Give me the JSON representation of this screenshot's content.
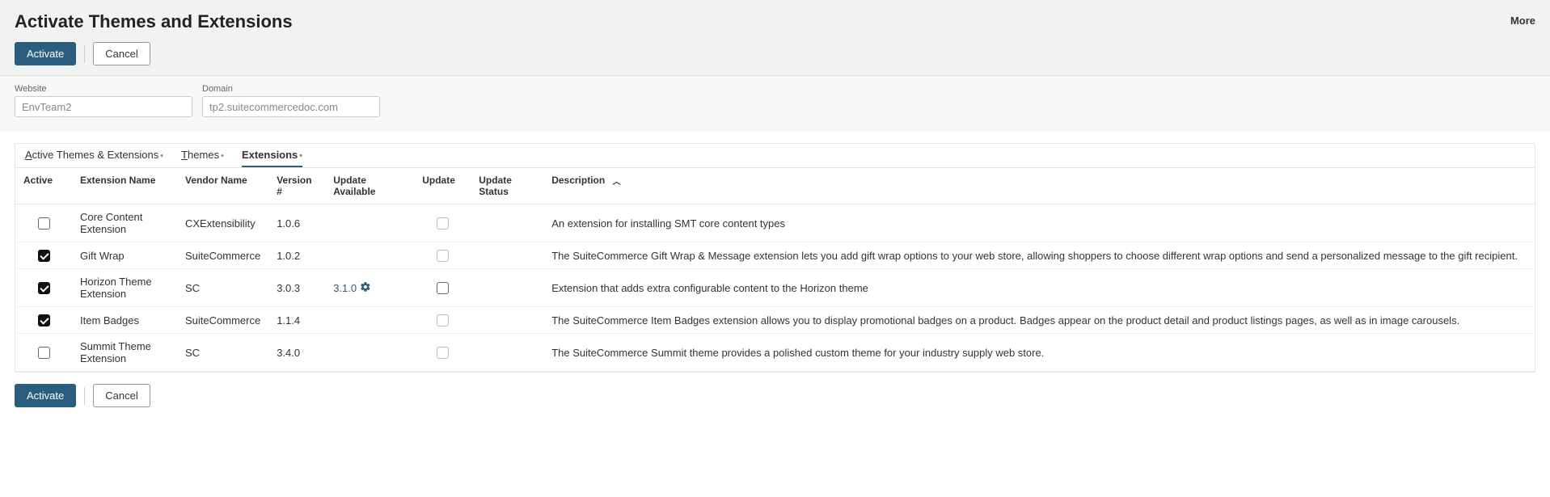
{
  "header": {
    "title": "Activate Themes and Extensions",
    "more": "More",
    "activate_label": "Activate",
    "cancel_label": "Cancel"
  },
  "filters": {
    "website": {
      "label": "Website",
      "value": "EnvTeam2"
    },
    "domain": {
      "label": "Domain",
      "value": "tp2.suitecommercedoc.com"
    }
  },
  "tabs": {
    "active_themes": "Active Themes & Extensions",
    "themes": "Themes",
    "extensions": "Extensions",
    "selected": "extensions"
  },
  "columns": {
    "active": "Active",
    "extension_name": "Extension Name",
    "vendor_name": "Vendor Name",
    "version": "Version #",
    "update_available": "Update Available",
    "update": "Update",
    "update_status": "Update Status",
    "description": "Description"
  },
  "sort": {
    "column": "description",
    "direction": "asc"
  },
  "rows": [
    {
      "active": false,
      "name": "Core Content Extension",
      "vendor": "CXExtensibility",
      "version": "1.0.6",
      "update_available": "",
      "update_checked": false,
      "update_disabled": true,
      "description": "An extension for installing SMT core content types"
    },
    {
      "active": true,
      "name": "Gift Wrap",
      "vendor": "SuiteCommerce",
      "version": "1.0.2",
      "update_available": "",
      "update_checked": false,
      "update_disabled": true,
      "description": "The SuiteCommerce Gift Wrap & Message extension lets you add gift wrap options to your web store, allowing shoppers to choose different wrap options and send a personalized message to the gift recipient."
    },
    {
      "active": true,
      "name": "Horizon Theme Extension",
      "vendor": "SC",
      "version": "3.0.3",
      "update_available": "3.1.0",
      "update_checked": false,
      "update_disabled": false,
      "description": "Extension that adds extra configurable content to the Horizon theme"
    },
    {
      "active": true,
      "name": "Item Badges",
      "vendor": "SuiteCommerce",
      "version": "1.1.4",
      "update_available": "",
      "update_checked": false,
      "update_disabled": true,
      "description": "The SuiteCommerce Item Badges extension allows you to display promotional badges on a product. Badges appear on the product detail and product listings pages, as well as in image carousels."
    },
    {
      "active": false,
      "name": "Summit Theme Extension",
      "vendor": "SC",
      "version": "3.4.0",
      "update_available": "",
      "update_checked": false,
      "update_disabled": true,
      "description": "The SuiteCommerce Summit theme provides a polished custom theme for your industry supply web store."
    }
  ],
  "footer": {
    "activate_label": "Activate",
    "cancel_label": "Cancel"
  }
}
